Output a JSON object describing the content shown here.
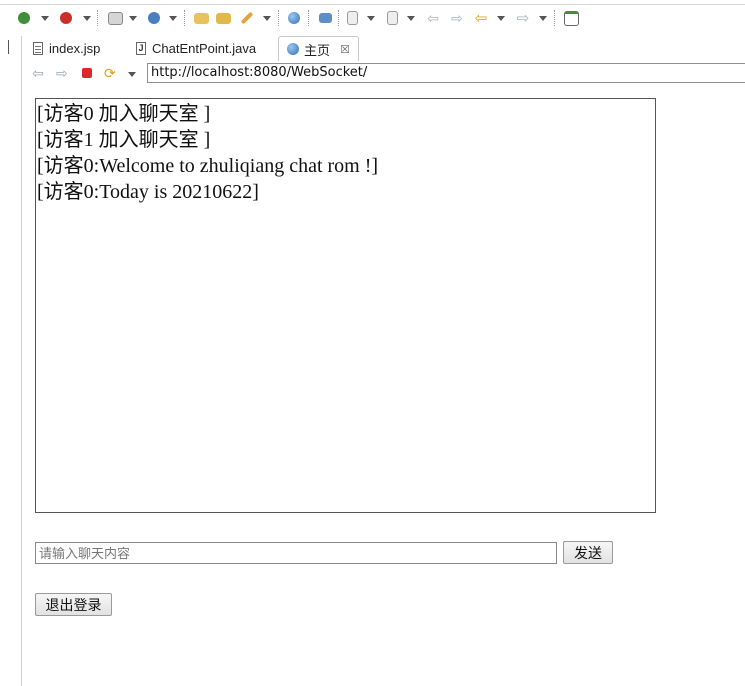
{
  "toolbar": {
    "icons": [
      "debug-icon",
      "run-icon",
      "new-server-icon",
      "external-tools-icon",
      "open-folder-icon",
      "open-task-icon",
      "pen-icon",
      "web-browser-icon",
      "search-icon",
      "next-annotation-icon",
      "previous-annotation-icon",
      "back-icon",
      "forward-icon",
      "back-history-icon",
      "forward-history-icon",
      "new-window-icon"
    ]
  },
  "tabs": [
    {
      "label": "index.jsp",
      "icon": "jsp-file-icon",
      "active": false
    },
    {
      "label": "ChatEntPoint.java",
      "icon": "java-file-icon",
      "active": false
    },
    {
      "label": "主页",
      "icon": "globe-icon",
      "active": true
    }
  ],
  "tab_close_glyph": "☒",
  "browser": {
    "url": "http://localhost:8080/WebSocket/"
  },
  "chat": {
    "messages": [
      "[访客0 加入聊天室 ]",
      "[访客1 加入聊天室 ]",
      "[访客0:Welcome to zhuliqiang chat rom !]",
      "[访客0:Today is 20210622]"
    ],
    "input_placeholder": "请输入聊天内容",
    "input_value": "",
    "send_label": "发送",
    "logout_label": "退出登录"
  },
  "colors": {
    "stop": "#e0252b",
    "refresh": "#d9a21b",
    "nav_disabled": "#9aa6b2"
  }
}
